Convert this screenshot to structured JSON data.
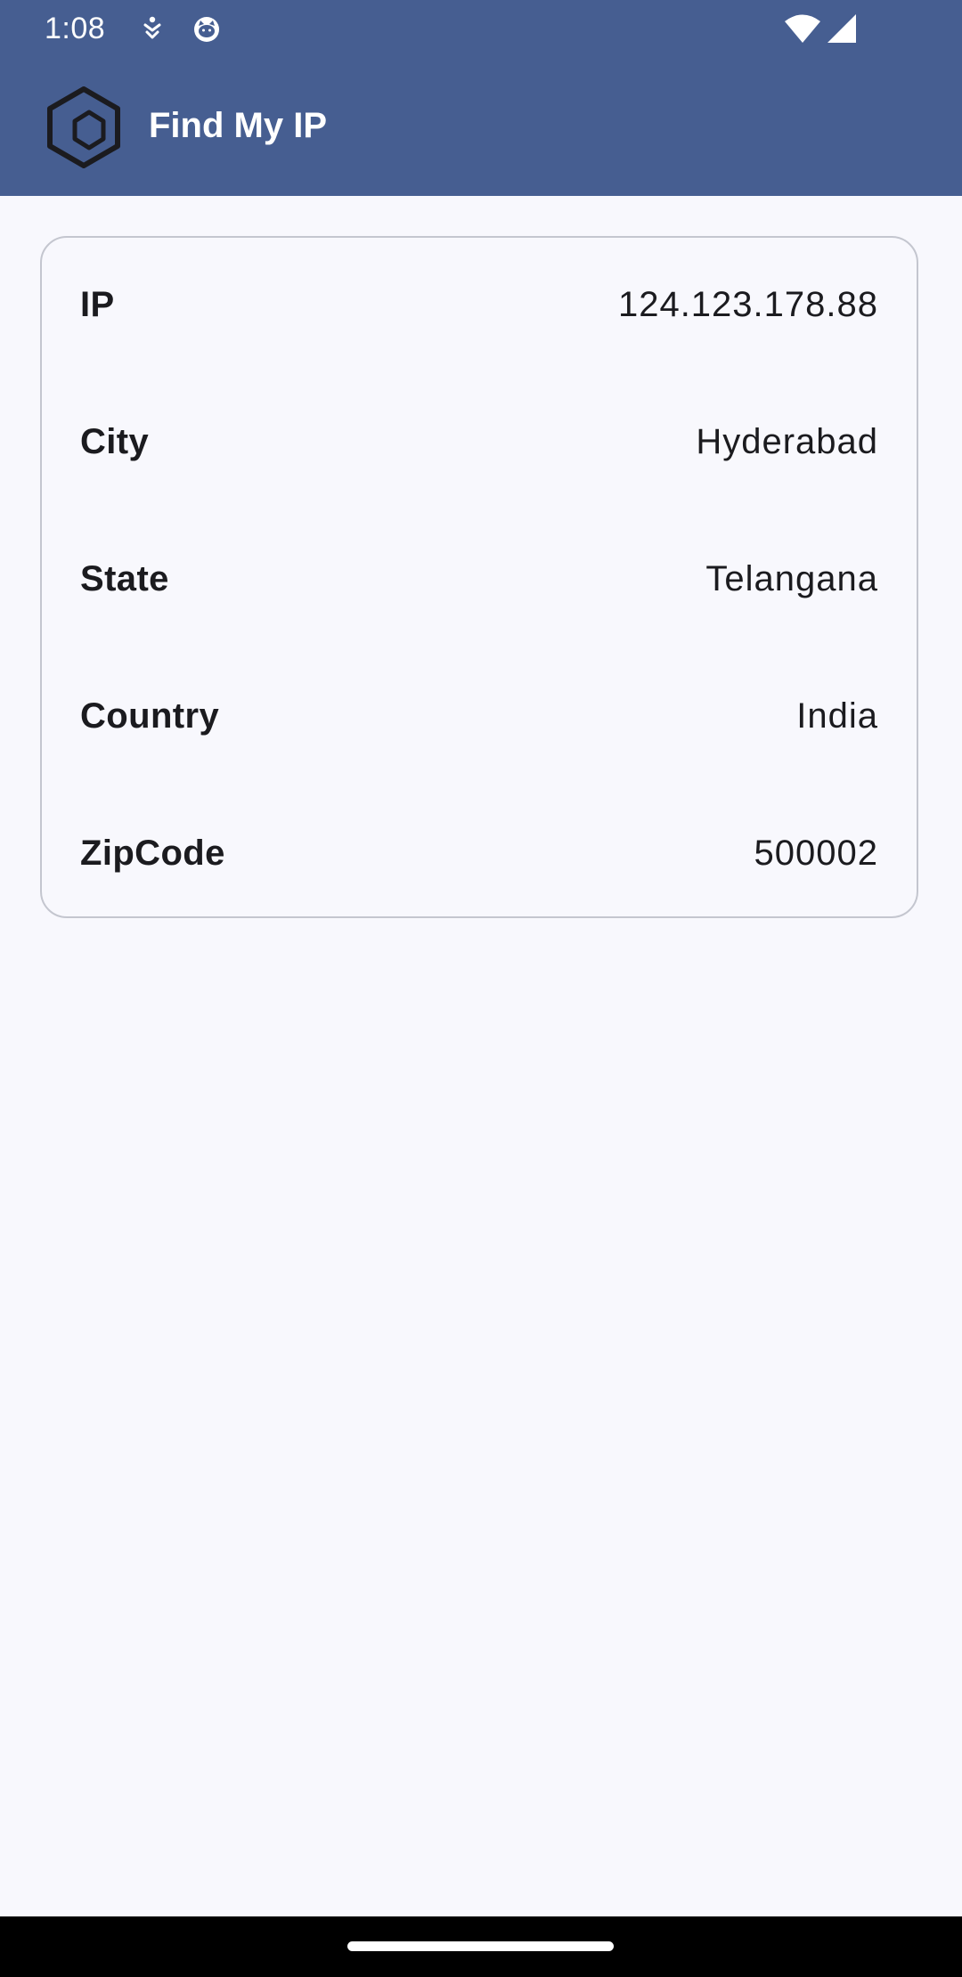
{
  "status_bar": {
    "time": "1:08",
    "icons": [
      "accessibility-icon",
      "cat-icon",
      "wifi-icon",
      "signal-icon"
    ]
  },
  "app_bar": {
    "title": "Find My IP",
    "logo_icon": "hexagon-logo-icon",
    "background_color": "#465e91"
  },
  "info": {
    "rows": [
      {
        "label": "IP",
        "value": "124.123.178.88"
      },
      {
        "label": "City",
        "value": "Hyderabad"
      },
      {
        "label": "State",
        "value": "Telangana"
      },
      {
        "label": "Country",
        "value": "India"
      },
      {
        "label": "ZipCode",
        "value": "500002"
      }
    ]
  }
}
